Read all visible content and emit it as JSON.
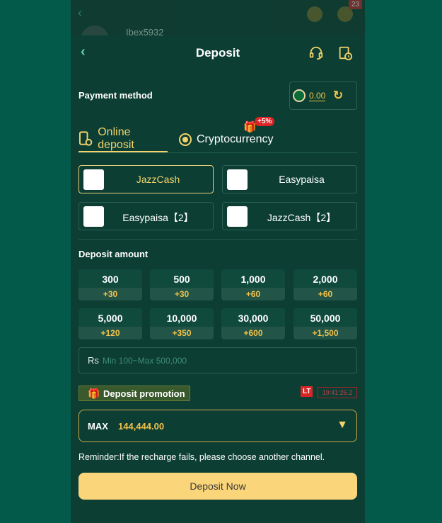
{
  "topbar": {
    "username": "Ibex5932",
    "badge": "23"
  },
  "header": {
    "title": "Deposit"
  },
  "payment_method": {
    "label": "Payment method",
    "balance": "0.00"
  },
  "tabs": [
    {
      "label": "Online deposit"
    },
    {
      "label": "Cryptocurrency",
      "promo": "+5%"
    }
  ],
  "channels": [
    {
      "name": "JazzCash"
    },
    {
      "name": "Easypaisa"
    },
    {
      "name": "Easypaisa【2】"
    },
    {
      "name": "JazzCash【2】"
    }
  ],
  "deposit_amount": {
    "label": "Deposit amount",
    "options": [
      {
        "value": "300",
        "bonus": "+30"
      },
      {
        "value": "500",
        "bonus": "+30"
      },
      {
        "value": "1,000",
        "bonus": "+60"
      },
      {
        "value": "2,000",
        "bonus": "+60"
      },
      {
        "value": "5,000",
        "bonus": "+120"
      },
      {
        "value": "10,000",
        "bonus": "+350"
      },
      {
        "value": "30,000",
        "bonus": "+600"
      },
      {
        "value": "50,000",
        "bonus": "+1,500"
      }
    ]
  },
  "amount_input": {
    "currency": "Rs",
    "placeholder": "Min 100~Max 500,000"
  },
  "promotion": {
    "label": "Deposit promotion",
    "lt_tag": "LT",
    "timer": "19:41:26.2"
  },
  "max_select": {
    "label": "MAX",
    "value": "144,444.00"
  },
  "reminder": "Reminder:If the recharge fails, please choose another channel.",
  "submit": {
    "label": "Deposit Now"
  },
  "colors": {
    "accent": "#f3d36a",
    "bonus": "#f3c14a",
    "background": "#0c3e33",
    "button": "#fbd57a"
  }
}
